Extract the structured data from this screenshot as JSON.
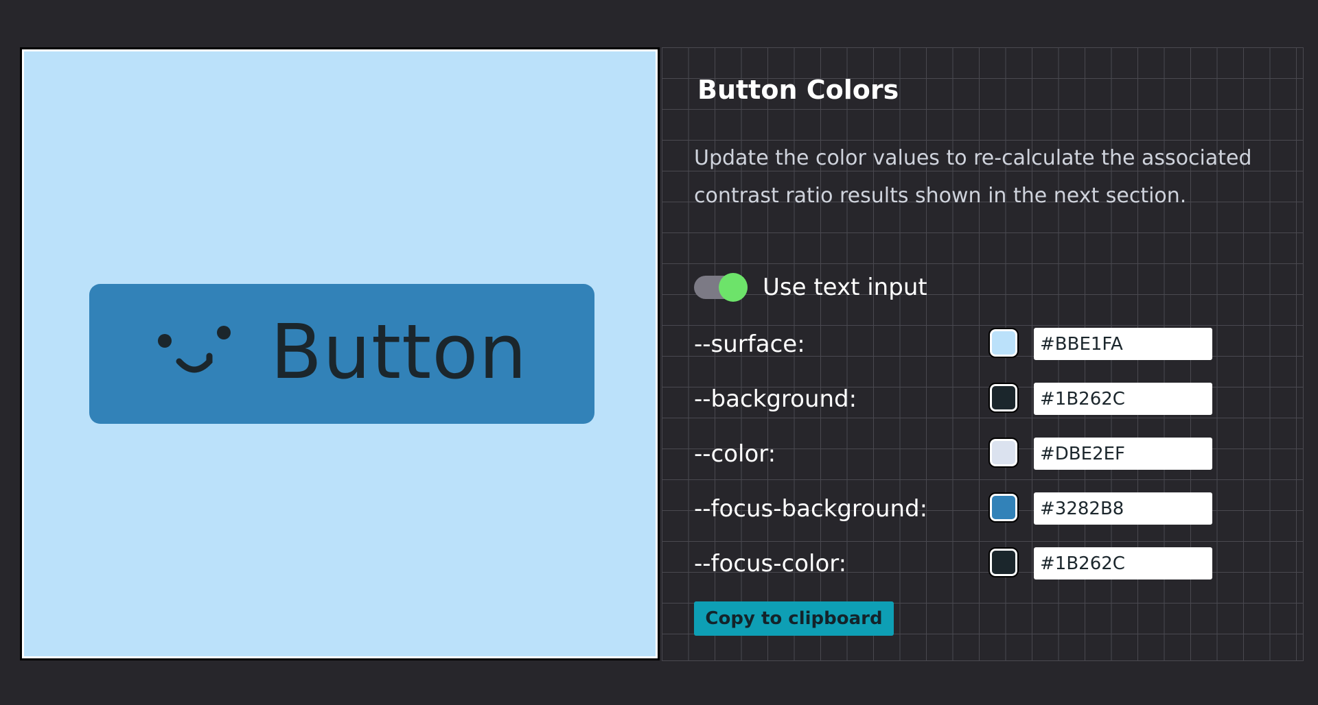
{
  "preview": {
    "button_label": "Button",
    "icon": "smile-icon",
    "colors": {
      "surface": "#BBE1FA",
      "focus_background": "#3282B8",
      "focus_color": "#1B262C"
    }
  },
  "controls": {
    "title": "Button Colors",
    "description": "Update the color values to re-calculate the associated contrast ratio results shown in the next section.",
    "toggle": {
      "label": "Use text input",
      "checked": true,
      "knob_color": "#6DE36A"
    },
    "variables": [
      {
        "label": "--surface:",
        "value": "#BBE1FA",
        "swatch": "#BBE1FA"
      },
      {
        "label": "--background:",
        "value": "#1B262C",
        "swatch": "#1B262C"
      },
      {
        "label": "--color:",
        "value": "#DBE2EF",
        "swatch": "#DBE2EF"
      },
      {
        "label": "--focus-background:",
        "value": "#3282B8",
        "swatch": "#3282B8"
      },
      {
        "label": "--focus-color:",
        "value": "#1B262C",
        "swatch": "#1B262C"
      }
    ],
    "copy_button": {
      "label": "Copy to clipboard",
      "color": "#0E9FB5"
    }
  }
}
